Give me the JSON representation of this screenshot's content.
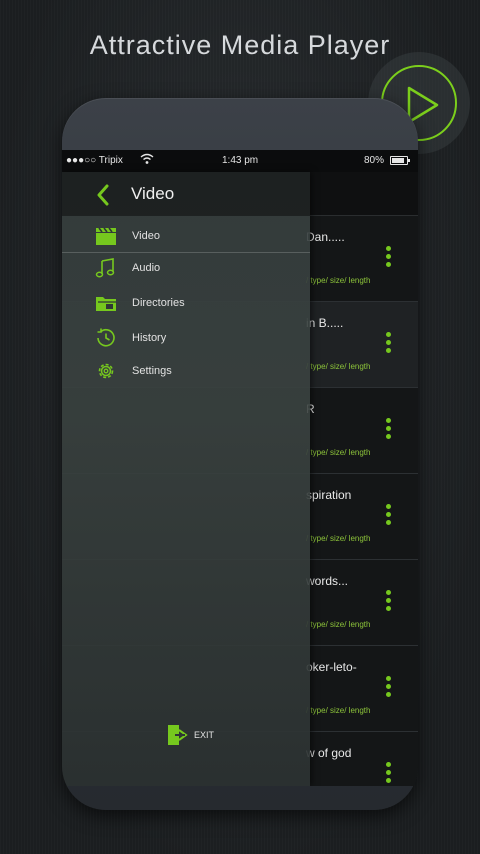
{
  "promo": {
    "title": "Attractive Media Player"
  },
  "status_bar": {
    "carrier": "●●●○○ Tripix",
    "time": "1:43 pm",
    "battery": "80%"
  },
  "drawer": {
    "title": "Video",
    "items": [
      {
        "label": "Video",
        "icon": "clapperboard-icon"
      },
      {
        "label": "Audio",
        "icon": "music-note-icon"
      },
      {
        "label": "Directories",
        "icon": "folder-icon"
      },
      {
        "label": "History",
        "icon": "history-clock-icon"
      },
      {
        "label": "Settings",
        "icon": "gear-icon"
      }
    ],
    "exit_label": "EXIT"
  },
  "list": {
    "rows": [
      {
        "title": "Dan.....",
        "meta": "/ type/ size/ length"
      },
      {
        "title": "in B.....",
        "meta": "/ type/ size/ length"
      },
      {
        "title": "R",
        "meta": "/ type/ size/ length"
      },
      {
        "title": "spiration",
        "meta": "/ type/ size/ length"
      },
      {
        "title": "words...",
        "meta": "/ type/ size/ length"
      },
      {
        "title": "oker-leto-",
        "meta": "/ type/ size/ length"
      },
      {
        "title": "w of god",
        "meta": ""
      }
    ]
  },
  "colors": {
    "accent": "#76c81e",
    "background": "#1e2123",
    "drawer": "#3a4240"
  }
}
